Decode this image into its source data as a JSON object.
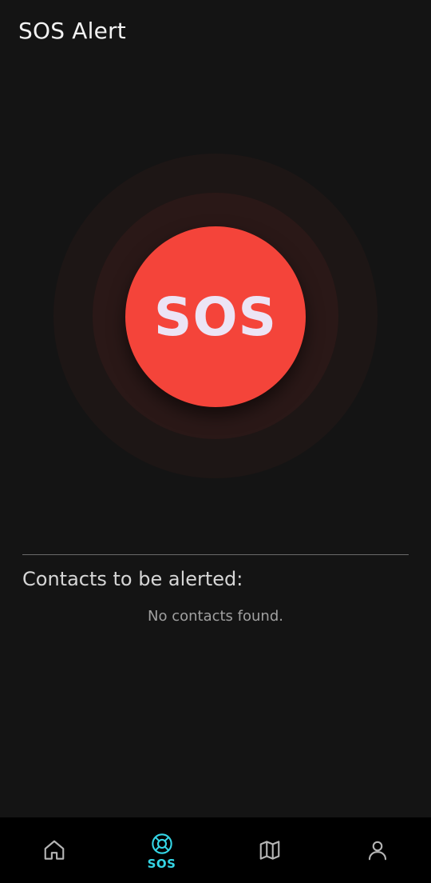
{
  "header": {
    "title": "SOS Alert"
  },
  "sos": {
    "button_label": "SOS"
  },
  "contacts": {
    "heading": "Contacts to be alerted:",
    "empty_message": "No contacts found."
  },
  "bottom_nav": {
    "items": [
      {
        "icon": "home-icon",
        "label": "",
        "active": false
      },
      {
        "icon": "lifebuoy-icon",
        "label": "SOS",
        "active": true
      },
      {
        "icon": "map-icon",
        "label": "",
        "active": false
      },
      {
        "icon": "user-icon",
        "label": "",
        "active": false
      }
    ],
    "active_color": "#35d6e6",
    "inactive_color": "#b5b5b5"
  },
  "colors": {
    "background": "#141414",
    "sos_button": "#f4443a",
    "sos_text": "#ece4f5"
  }
}
